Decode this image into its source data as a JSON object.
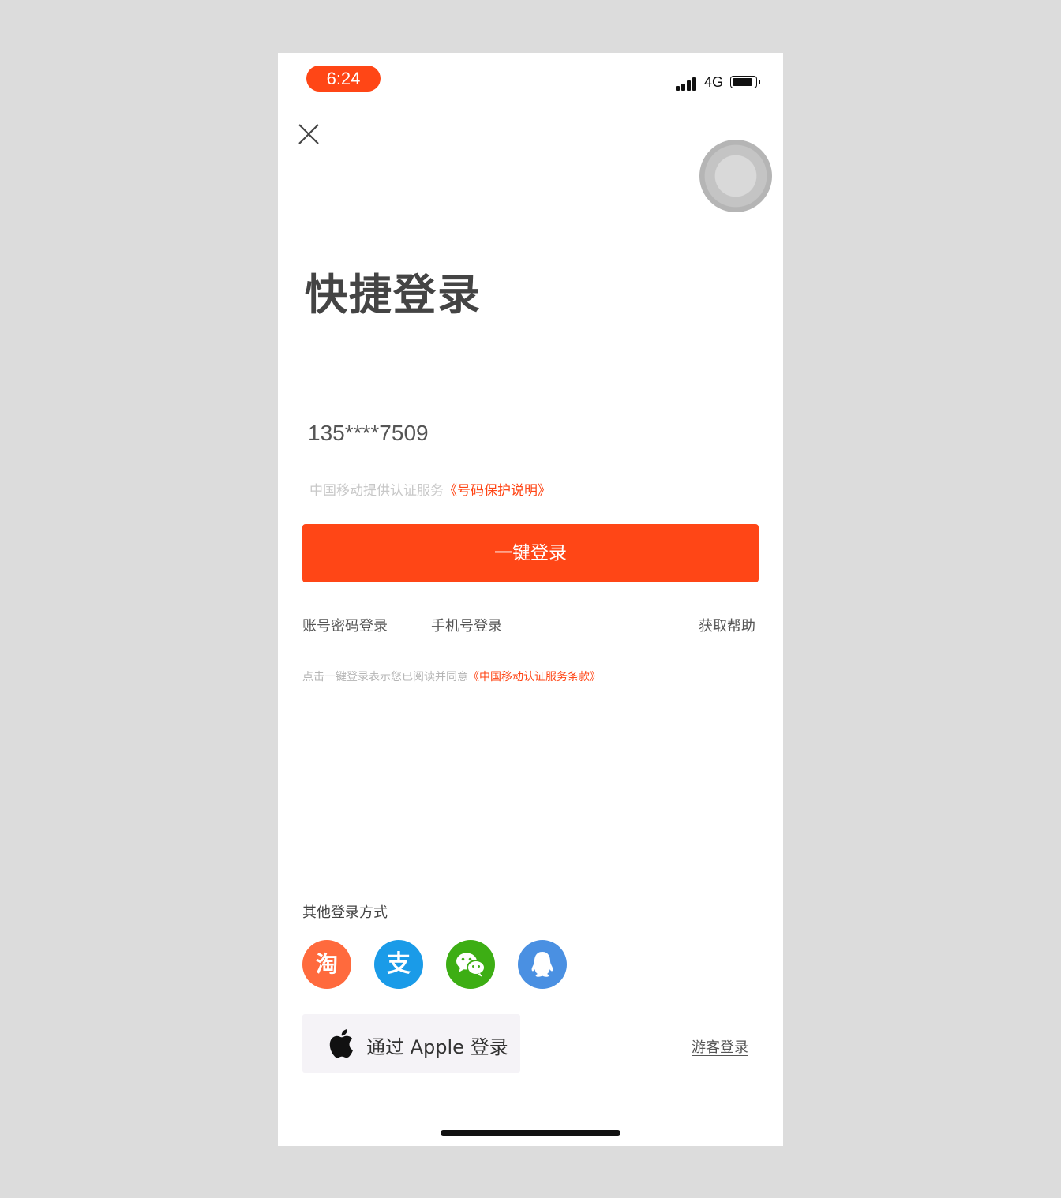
{
  "status_bar": {
    "time": "6:24",
    "network": "4G",
    "accent_color": "#ff4616"
  },
  "icons": {
    "close": "close-icon",
    "assistive_touch": "assistive-touch-icon",
    "taobao": "taobao-icon",
    "alipay": "alipay-icon",
    "wechat": "wechat-icon",
    "qq": "qq-icon",
    "apple": "apple-icon"
  },
  "main": {
    "title": "快捷登录",
    "phone_number": "135****7509",
    "cert_text": "中国移动提供认证服务",
    "cert_link": "《号码保护说明》",
    "login_button": "一键登录",
    "password_login": "账号密码登录",
    "phone_login": "手机号登录",
    "help": "获取帮助",
    "agreement_text": "点击一键登录表示您已阅读并同意",
    "agreement_link": "《中国移动认证服务条款》"
  },
  "other": {
    "title": "其他登录方式",
    "taobao_glyph": "淘",
    "alipay_glyph": "支",
    "apple_login": "通过 Apple 登录",
    "guest_login": "游客登录"
  },
  "colors": {
    "brand": "#ff4616",
    "taobao": "#ff6a3d",
    "alipay": "#1a9be8",
    "wechat": "#3dae14",
    "qq": "#4a90e2"
  }
}
